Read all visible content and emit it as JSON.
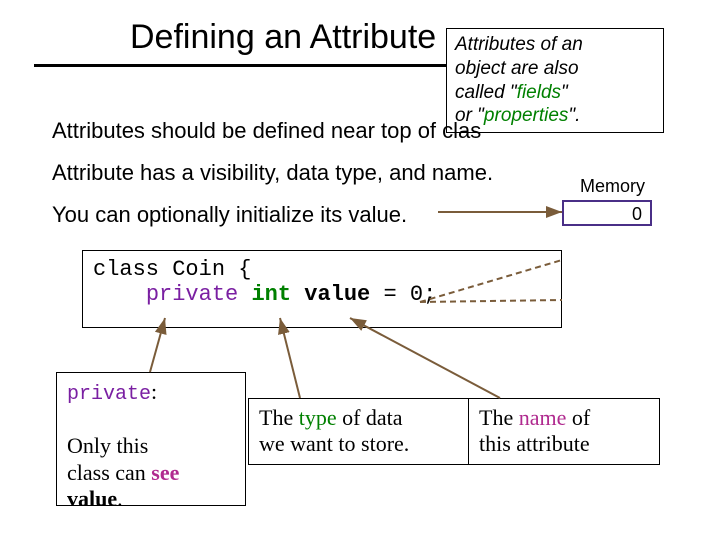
{
  "title": "Defining an Attribute",
  "tip": {
    "l1": "Attributes of an",
    "l2": "object are also",
    "l3a": "called \"",
    "l3b": "fields",
    "l3c": "\"",
    "l4a": "or \"",
    "l4b": "properties",
    "l4c": "\"."
  },
  "body": {
    "line1": "Attributes should be defined near top of clas",
    "line2": "Attribute has a visibility, data type, and name.",
    "line3": "You can optionally initialize its value."
  },
  "memory": {
    "label": "Memory",
    "value": "0"
  },
  "code": {
    "line1": "class Coin {",
    "indent": "    ",
    "priv": "private",
    "int": "int",
    "name": "value",
    "rest": " = 0;"
  },
  "captions": {
    "private": {
      "kw": "private",
      "colon": ":",
      "l1": "Only this",
      "l2a": "class can ",
      "l2b": "see",
      "l3": "value",
      "l3b": "."
    },
    "type": {
      "l1a": "The ",
      "l1b": "type",
      "l1c": " of data",
      "l2": "we want to store."
    },
    "name": {
      "l1a": "The ",
      "l1b": "name",
      "l1c": " of",
      "l2": "this attribute"
    }
  }
}
